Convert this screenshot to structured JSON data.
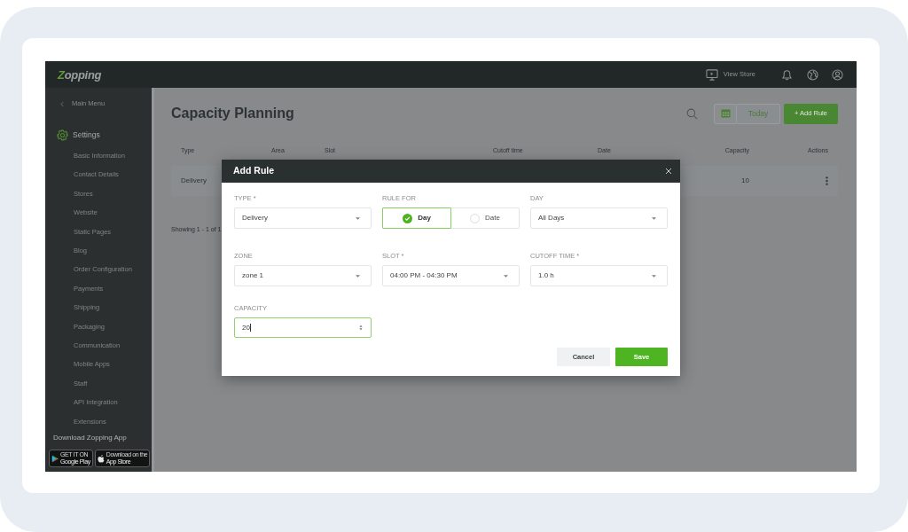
{
  "header": {
    "logo": "Zopping",
    "view_store": "View Store"
  },
  "sidebar": {
    "back": "Main Menu",
    "section": "Settings",
    "items": [
      "Basic Information",
      "Contact Details",
      "Stores",
      "Website",
      "Static Pages",
      "Blog",
      "Order Configuration",
      "Payments",
      "Shipping",
      "Packaging",
      "Communication",
      "Mobile Apps",
      "Staff",
      "API Integration",
      "Extensions"
    ],
    "download": {
      "title": "Download Zopping App",
      "badges": [
        {
          "kind": "google_play",
          "caption": "GET IT ON",
          "label": "Google Play"
        },
        {
          "kind": "app_store",
          "caption": "Download on the",
          "label": "App Store"
        }
      ]
    }
  },
  "page": {
    "title": "Capacity Planning",
    "today": "Today",
    "add_rule": "+ Add Rule",
    "table": {
      "columns": [
        "Type",
        "Area",
        "Slot",
        "Cutoff time",
        "Date",
        "Capacity",
        "Actions"
      ],
      "rows": [
        {
          "type": "Delivery",
          "capacity": "10"
        }
      ]
    },
    "footer": "Showing 1 - 1 of 1"
  },
  "modal": {
    "title": "Add Rule",
    "fields": [
      {
        "kind": "select",
        "label": "TYPE *",
        "value": "Delivery"
      },
      {
        "kind": "toggle",
        "label": "RULE FOR",
        "options": [
          {
            "label": "Day",
            "selected": true
          },
          {
            "label": "Date",
            "selected": false
          }
        ]
      },
      {
        "kind": "select",
        "label": "DAY",
        "value": "All Days"
      },
      {
        "kind": "select",
        "label": "ZONE",
        "value": "zone 1"
      },
      {
        "kind": "select",
        "label": "SLOT *",
        "value": "04:00 PM - 04:30 PM"
      },
      {
        "kind": "select",
        "label": "CUTOFF TIME *",
        "value": "1.0 h"
      },
      {
        "kind": "number",
        "label": "CAPACITY",
        "value": "20",
        "focused": true
      }
    ],
    "buttons": [
      {
        "kind": "secondary",
        "label": "Cancel"
      },
      {
        "kind": "primary",
        "label": "Save"
      }
    ]
  }
}
